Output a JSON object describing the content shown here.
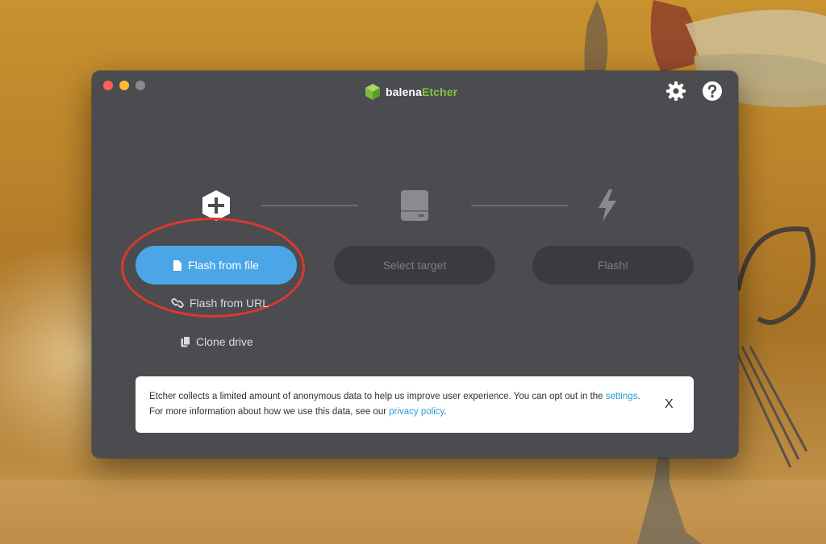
{
  "app": {
    "brand_prefix": "balena",
    "brand_suffix": "Etcher",
    "accent_color": "#85c441",
    "icons": {
      "logo": "cube-icon",
      "settings": "gear-icon",
      "help": "question-icon"
    }
  },
  "steps": {
    "source": {
      "icon": "plus-hexagon-icon",
      "button_label": "Flash from file",
      "button_icon": "file-icon",
      "button_color": "#4aa6e6",
      "url_label": "Flash from URL",
      "url_icon": "link-icon",
      "clone_label": "Clone drive",
      "clone_icon": "copy-icon"
    },
    "target": {
      "icon": "drive-icon",
      "button_label": "Select target"
    },
    "flash": {
      "icon": "lightning-icon",
      "button_label": "Flash!"
    }
  },
  "notice": {
    "line1_text": "Etcher collects a limited amount of anonymous data to help us improve user experience. You can opt out in the ",
    "line1_link": "settings",
    "line1_end": ".",
    "line2_text": "For more information about how we use this data, see our ",
    "line2_link": "privacy policy",
    "line2_end": ".",
    "close_label": "X"
  }
}
